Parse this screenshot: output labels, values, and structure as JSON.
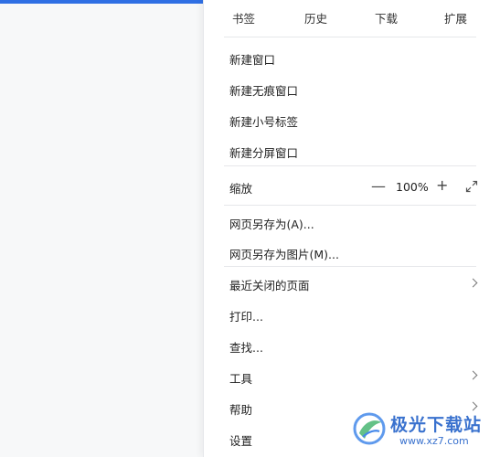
{
  "top_tabs": [
    "书签",
    "历史",
    "下载",
    "扩展"
  ],
  "group_new": [
    "新建窗口",
    "新建无痕窗口",
    "新建小号标签",
    "新建分屏窗口"
  ],
  "zoom": {
    "label": "缩放",
    "minus": "—",
    "value": "100%",
    "plus": "+"
  },
  "group_save": [
    "网页另存为(A)...",
    "网页另存为图片(M)..."
  ],
  "group_misc": [
    "最近关闭的页面",
    "打印...",
    "查找...",
    "工具",
    "帮助",
    "设置"
  ],
  "watermark": {
    "title": "极光下载站",
    "url": "www.xz7.com"
  },
  "colors": {
    "accent": "#2f6fe4",
    "watermark": "#2563c9"
  }
}
